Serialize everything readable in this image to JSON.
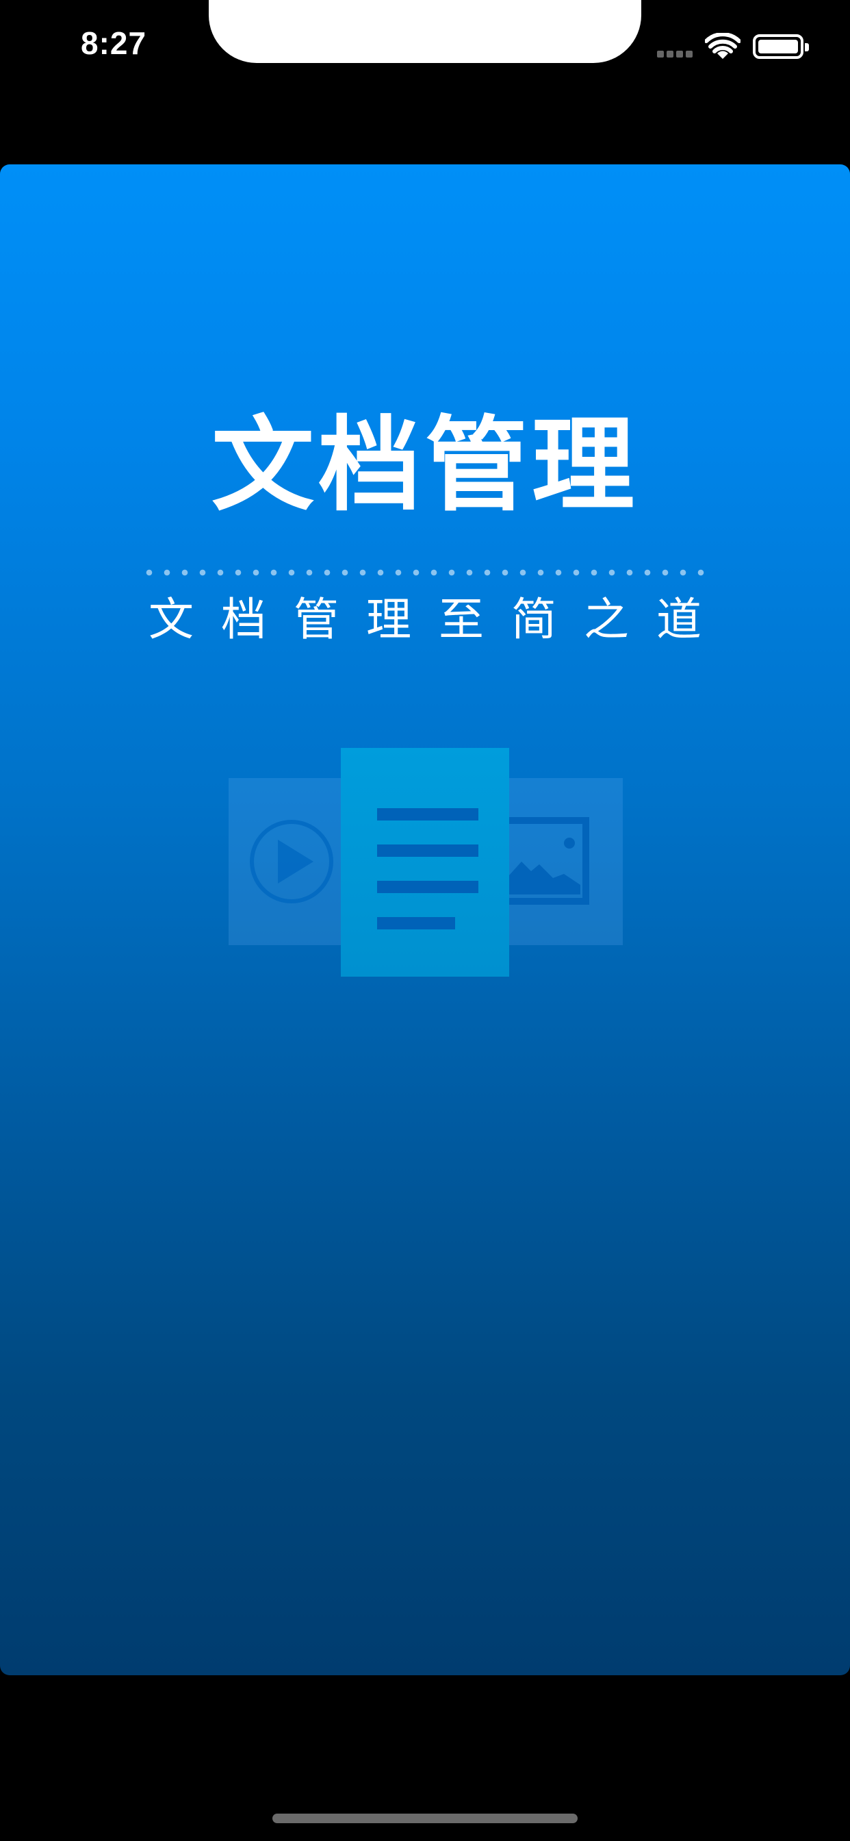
{
  "status_bar": {
    "time": "8:27"
  },
  "splash": {
    "title": "文档管理",
    "subtitle": "文档管理至简之道"
  },
  "colors": {
    "gradient_top": "#008ff7",
    "gradient_bottom": "#003c6f",
    "doc_card": "#009ddc",
    "doc_lines": "#0062b8"
  },
  "icons": {
    "video": "play-circle-icon",
    "document": "document-lines-icon",
    "image": "image-icon"
  }
}
